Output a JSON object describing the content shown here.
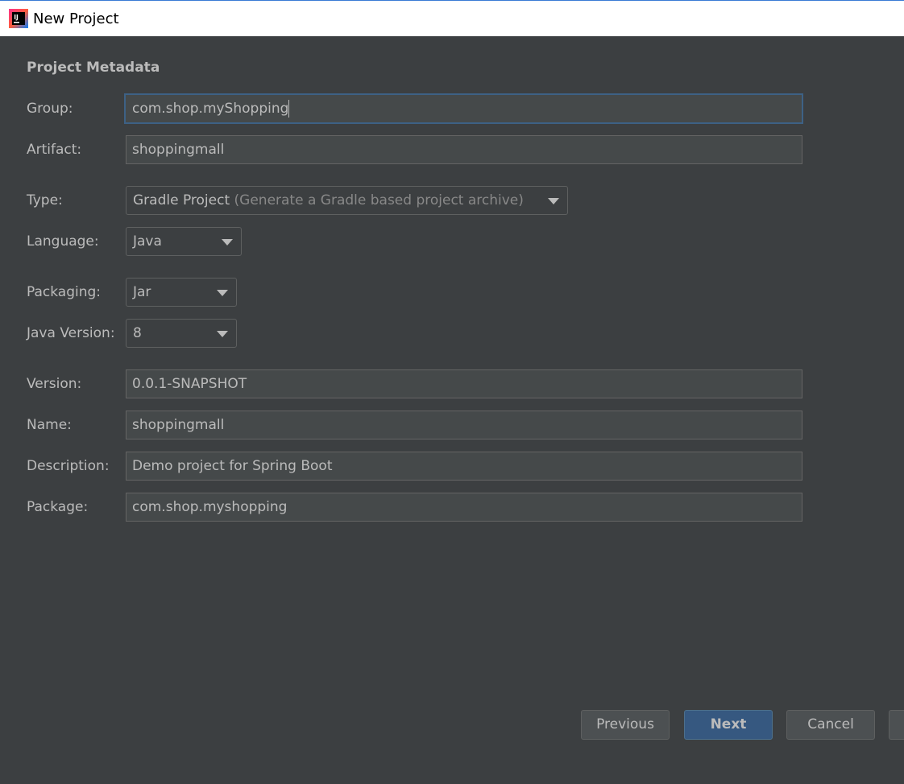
{
  "window": {
    "title": "New Project",
    "icon": "intellij-idea-icon"
  },
  "section_title": "Project Metadata",
  "fields": {
    "group": {
      "label": "Group:",
      "value": "com.shop.myShopping"
    },
    "artifact": {
      "label": "Artifact:",
      "value": "shoppingmall"
    },
    "type": {
      "label": "Type:",
      "value": "Gradle Project",
      "hint": "(Generate a Gradle based project archive)"
    },
    "language": {
      "label": "Language:",
      "value": "Java"
    },
    "packaging": {
      "label": "Packaging:",
      "value": "Jar"
    },
    "java_version": {
      "label": "Java Version:",
      "value": "8"
    },
    "version": {
      "label": "Version:",
      "value": "0.0.1-SNAPSHOT"
    },
    "name": {
      "label": "Name:",
      "value": "shoppingmall"
    },
    "description": {
      "label": "Description:",
      "value": "Demo project for Spring Boot"
    },
    "package": {
      "label": "Package:",
      "value": "com.shop.myshopping"
    }
  },
  "buttons": {
    "previous": "Previous",
    "next": "Next",
    "cancel": "Cancel"
  },
  "colors": {
    "background": "#3c3f41",
    "field_background": "#45494a",
    "text": "#bbbbbb",
    "focus_border": "#3d6185",
    "primary_button": "#365880"
  }
}
